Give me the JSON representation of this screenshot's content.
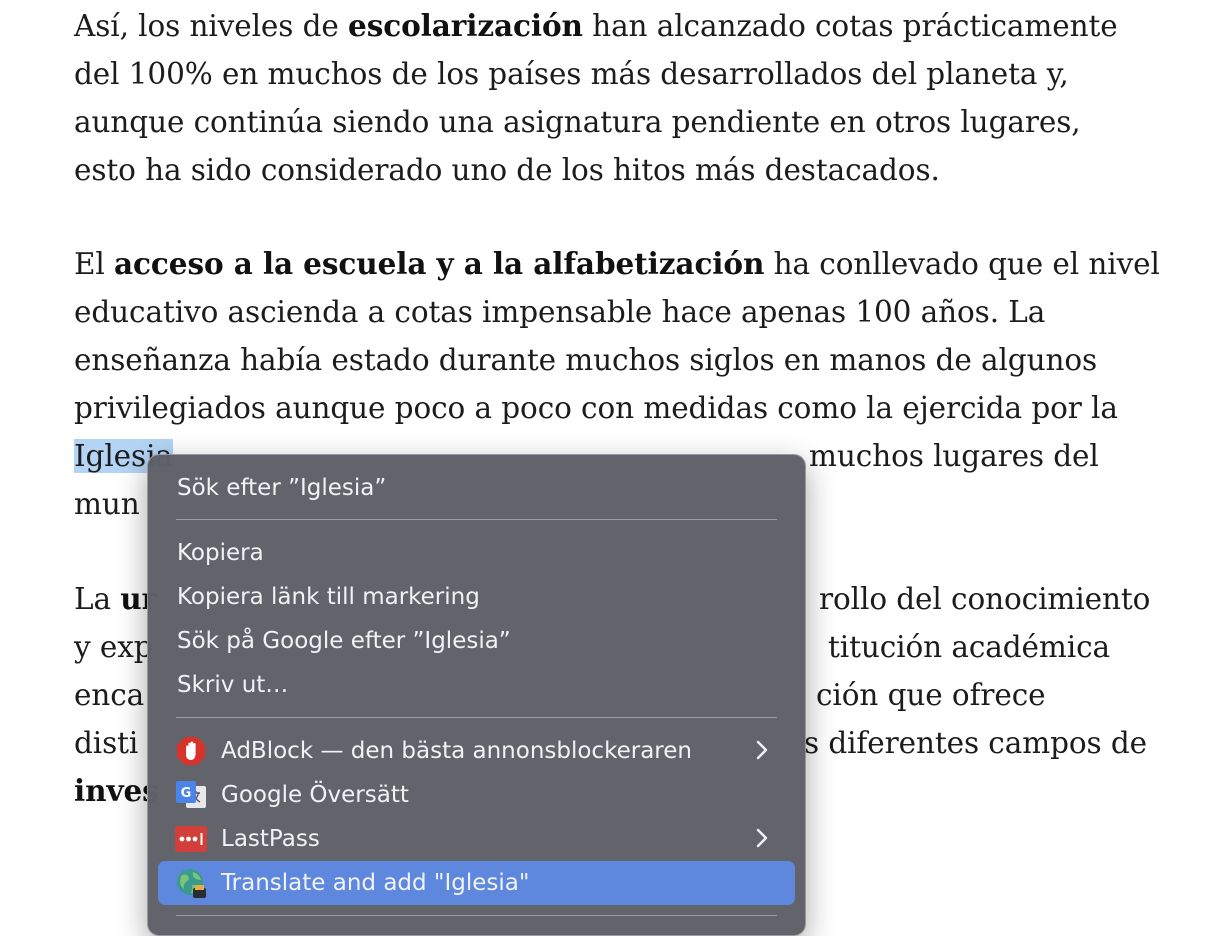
{
  "article": {
    "p1": {
      "l1a": "Así, los niveles de ",
      "l1b": "escolarización",
      "l1c": " han alcanzado cotas prácticamente",
      "l2": "del 100% en muchos de los países más desarrollados del planeta y,",
      "l3": "aunque continúa siendo una asignatura pendiente en otros lugares,",
      "l4": "esto ha sido considerado uno de los hitos más destacados."
    },
    "p2": {
      "l1a": "El ",
      "l1b": "acceso a la escuela y a la alfabetización",
      "l1c": " ha conllevado que el nivel",
      "l2": "educativo ascienda a cotas impensable hace apenas 100 años. La",
      "l3": "enseñanza había estado durante muchos siglos en manos de algunos",
      "l4": "privilegiados aunque poco a poco con medidas como la ejercida por la",
      "l5_selected": "Iglesia",
      "l5_rest": " muchos lugares del",
      "l6": "mun"
    },
    "p3": {
      "l1a": "La ",
      "l1b": "ur",
      "l1c": "rollo del conocimiento",
      "l2a": "y exp",
      "l2b": "titución académica",
      "l3a": "enca",
      "l3b": "ción que ofrece",
      "l4a": "disti",
      "l4b": "s diferentes campos de",
      "l5": "inves"
    }
  },
  "context_menu": {
    "search_selection": "Sök efter ”Iglesia”",
    "copy": "Kopiera",
    "copy_link": "Kopiera länk till markering",
    "search_google": "Sök på Google efter ”Iglesia”",
    "print": "Skriv ut…",
    "adblock": "AdBlock — den bästa annonsblockeraren",
    "google_translate": "Google Översätt",
    "lastpass": "LastPass",
    "translate_add": "Translate and add \"Iglesia\""
  },
  "icons": {
    "adblock": "adblock-hand-icon",
    "google_translate": "google-translate-icon",
    "lastpass": "lastpass-icon",
    "translate_add": "globe-translate-icon",
    "submenu": "chevron-right-icon"
  },
  "colors": {
    "selection": "#b3d4f5",
    "menu_background": "#606068",
    "menu_highlight": "#5d88de",
    "adblock_red": "#d8332a",
    "lastpass_red": "#d23f3a"
  }
}
